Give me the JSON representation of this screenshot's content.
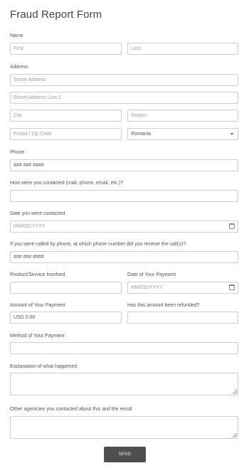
{
  "title": "Fraud Report Form",
  "name": {
    "label": "Name",
    "first_placeholder": "First",
    "last_placeholder": "Last"
  },
  "address": {
    "label": "Address",
    "street_placeholder": "Street Address",
    "street2_placeholder": "Street Address Line 2",
    "city_placeholder": "City",
    "region_placeholder": "Region",
    "postal_placeholder": "Postal / Zip Code",
    "country_value": "Romania"
  },
  "phone": {
    "label": "Phone",
    "placeholder": "### ### ####"
  },
  "contact_method": {
    "label": "How were you contacted (mail, phone, email, etc.)?"
  },
  "date_contacted": {
    "label": "Date you were contacted",
    "placeholder": "MM/DD/YYYY"
  },
  "called_phone": {
    "label": "If you were called by phone, at which phone number did you receive the call(s)?",
    "placeholder": "### ### ####"
  },
  "product": {
    "label": "Product/Service Involved"
  },
  "payment_date": {
    "label": "Date of Your Payment",
    "placeholder": "MM/DD/YYYY"
  },
  "payment_amount": {
    "label": "Amount of Your Payment",
    "value": "USD  0.00"
  },
  "refunded": {
    "label": "Has this amount been refunded?"
  },
  "payment_method": {
    "label": "Method of Your Payment"
  },
  "explanation": {
    "label": "Explanation of what happened"
  },
  "other_agencies": {
    "label": "Other agentcies you contacted about this and the result"
  },
  "send_label": "SEND",
  "icons": {
    "calendar": "calendar-icon",
    "dropdown": "chevron-down-icon",
    "resize": "resize-handle-icon"
  }
}
